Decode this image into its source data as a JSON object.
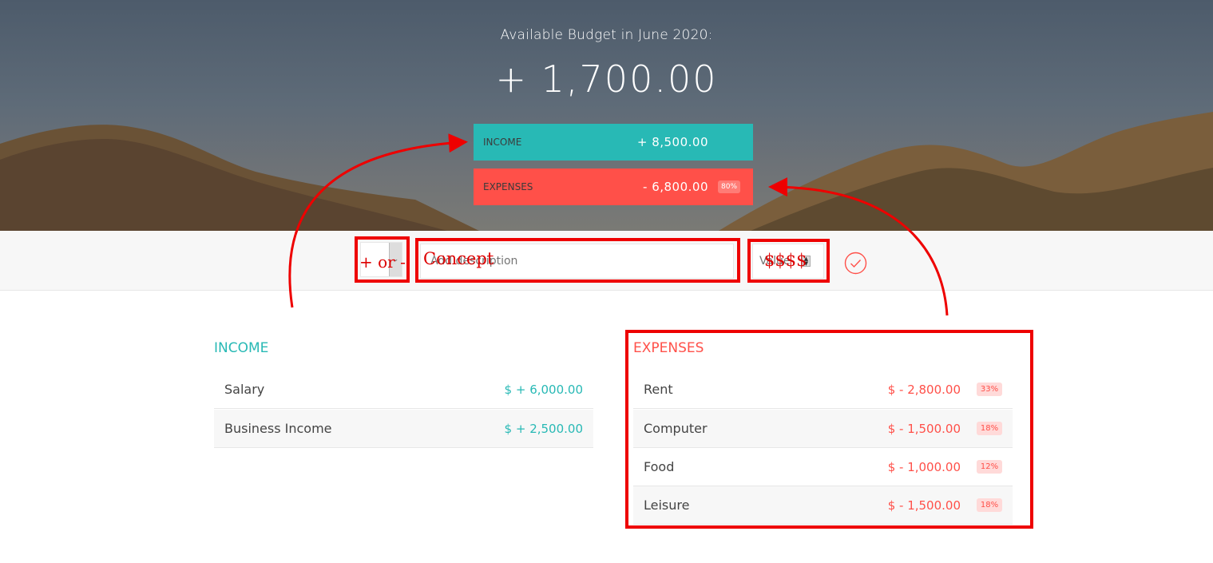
{
  "header": {
    "title": "Available Budget in June 2020:",
    "budget": "+ 1,700.00",
    "income": {
      "label": "INCOME",
      "value": "+ 8,500.00"
    },
    "expenses": {
      "label": "EXPENSES",
      "value": "- 6,800.00",
      "percentage": "80%"
    }
  },
  "add_bar": {
    "type_value": "",
    "description_placeholder": "Add description",
    "value_placeholder": "Value"
  },
  "annotations": {
    "type_note": "+ or -",
    "concept_note": "Concept",
    "value_note": "$$$$"
  },
  "income": {
    "title": "INCOME",
    "items": [
      {
        "description": "Salary",
        "value": "$ + 6,000.00"
      },
      {
        "description": "Business Income",
        "value": "$ + 2,500.00"
      }
    ]
  },
  "expenses": {
    "title": "EXPENSES",
    "items": [
      {
        "description": "Rent",
        "value": "$ - 2,800.00",
        "percentage": "33%"
      },
      {
        "description": "Computer",
        "value": "$ - 1,500.00",
        "percentage": "18%"
      },
      {
        "description": "Food",
        "value": "$ - 1,000.00",
        "percentage": "12%"
      },
      {
        "description": "Leisure",
        "value": "$ - 1,500.00",
        "percentage": "18%"
      }
    ]
  },
  "colors": {
    "income": "#28b9b5",
    "expense": "#ff5049",
    "annotation": "#e00000"
  },
  "icons": {
    "add_button": "check-circle-icon",
    "type_select": "chevron-down-icon"
  }
}
